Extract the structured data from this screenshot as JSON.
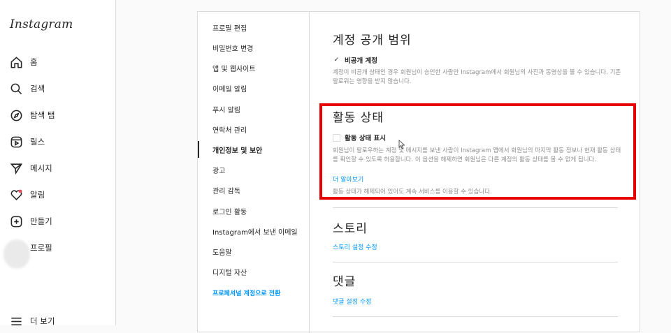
{
  "app": {
    "logo": "Instagram"
  },
  "nav": {
    "items": [
      {
        "label": "홈",
        "icon": "home-icon"
      },
      {
        "label": "검색",
        "icon": "search-icon"
      },
      {
        "label": "탐색 탭",
        "icon": "compass-icon"
      },
      {
        "label": "릴스",
        "icon": "reels-icon"
      },
      {
        "label": "메시지",
        "icon": "send-icon"
      },
      {
        "label": "알림",
        "icon": "heart-icon"
      },
      {
        "label": "만들기",
        "icon": "plus-square-icon"
      },
      {
        "label": "프로필",
        "icon": "avatar"
      }
    ],
    "more": "더 보기"
  },
  "settings_menu": {
    "items": [
      "프로필 편집",
      "비밀번호 변경",
      "앱 및 웹사이트",
      "이메일 알림",
      "푸시 알림",
      "연락처 관리",
      "개인정보 및 보안",
      "광고",
      "관리 감독",
      "로그인 활동",
      "Instagram에서 보낸 이메일",
      "도움말",
      "디지털 자산"
    ],
    "active": "개인정보 및 보안",
    "professional_link": "프로페셔널 계정으로 전환"
  },
  "privacy": {
    "title": "계정 공개 범위",
    "checkbox_label": "비공개 계정",
    "checked": true,
    "description": "계정이 비공개 상태인 경우 회원님이 승인한 사람만 Instagram에서 회원님의 사진과 동영상을 볼 수 있습니다. 기존 팔로워는 영향을 받지 않습니다."
  },
  "activity": {
    "title": "활동 상태",
    "checkbox_label": "활동 상태 표시",
    "checked": false,
    "description": "회원님이 팔로우하는 계정 및 메시지를 보낸 사람이 Instagram 앱에서 회원님의 마지막 활동 정보나 현재 활동 상태를 확인할 수 있도록 허용합니다. 이 옵션을 해제하면 회원님은 다른 계정의 활동 상태를 볼 수 없게 됩니다.",
    "learn_more": "더 알아보기",
    "note": "활동 상태가 해제되어 있어도 계속 서비스를 이용할 수 있습니다."
  },
  "story": {
    "title": "스토리",
    "link": "스토리 설정 수정"
  },
  "comments": {
    "title": "댓글",
    "link": "댓글 설정 수정"
  },
  "colors": {
    "highlight": "#e60000",
    "link": "#0095f6"
  }
}
